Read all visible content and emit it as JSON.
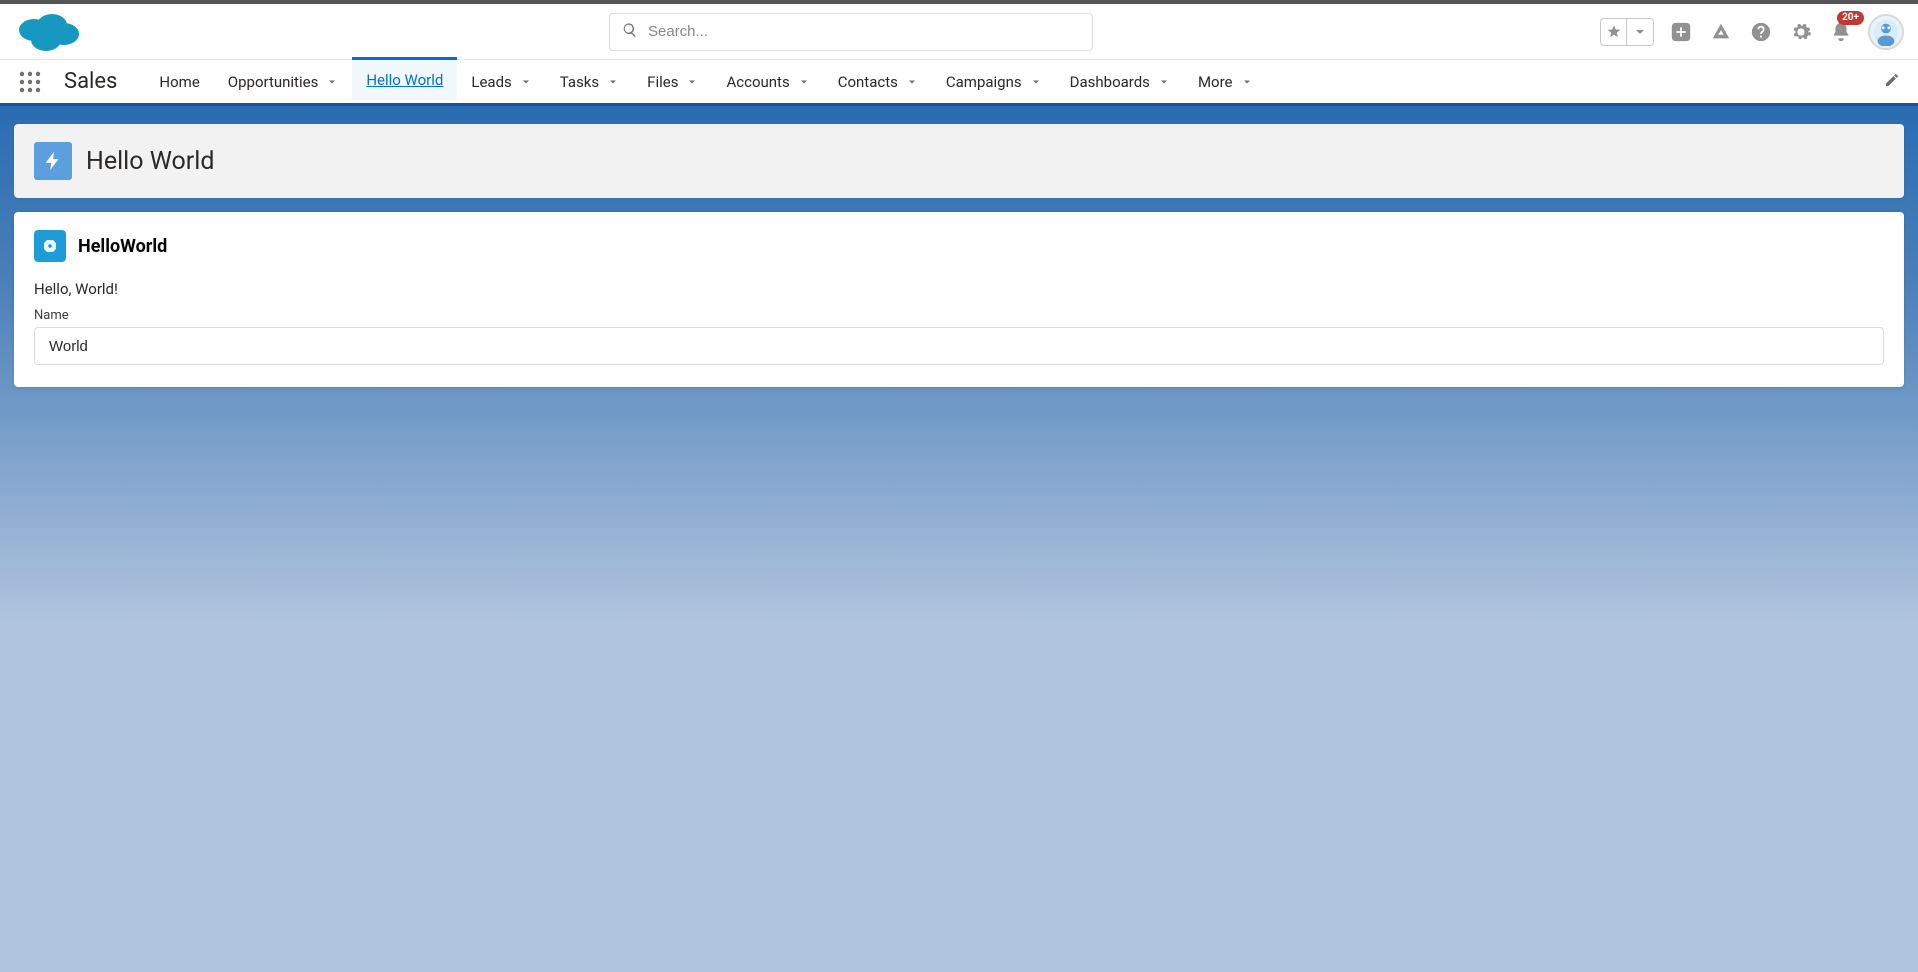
{
  "header": {
    "search_placeholder": "Search...",
    "notification_badge": "20+"
  },
  "nav": {
    "app_name": "Sales",
    "items": [
      {
        "label": "Home",
        "dropdown": false,
        "active": false
      },
      {
        "label": "Opportunities",
        "dropdown": true,
        "active": false
      },
      {
        "label": "Hello World",
        "dropdown": false,
        "active": true
      },
      {
        "label": "Leads",
        "dropdown": true,
        "active": false
      },
      {
        "label": "Tasks",
        "dropdown": true,
        "active": false
      },
      {
        "label": "Files",
        "dropdown": true,
        "active": false
      },
      {
        "label": "Accounts",
        "dropdown": true,
        "active": false
      },
      {
        "label": "Contacts",
        "dropdown": true,
        "active": false
      },
      {
        "label": "Campaigns",
        "dropdown": true,
        "active": false
      },
      {
        "label": "Dashboards",
        "dropdown": true,
        "active": false
      },
      {
        "label": "More",
        "dropdown": true,
        "active": false
      }
    ]
  },
  "page_header": {
    "title": "Hello World"
  },
  "component": {
    "title": "HelloWorld",
    "greeting": "Hello, World!",
    "field_label": "Name",
    "field_value": "World"
  }
}
